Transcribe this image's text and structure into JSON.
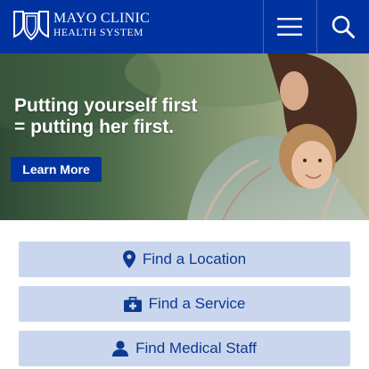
{
  "header": {
    "brand_line1": "MAYO CLINIC",
    "brand_line2": "HEALTH SYSTEM",
    "menu_icon": "hamburger-menu-icon",
    "search_icon": "search-icon",
    "background_color": "#0033a0"
  },
  "hero": {
    "headline_line1": "Putting yourself first",
    "headline_line2": "= putting her first.",
    "cta_label": "Learn More"
  },
  "quick_links": [
    {
      "label": "Find a Location",
      "icon": "location-pin-icon"
    },
    {
      "label": "Find a Service",
      "icon": "medical-kit-icon"
    },
    {
      "label": "Find Medical Staff",
      "icon": "person-icon"
    }
  ],
  "colors": {
    "brand_blue": "#0033a0",
    "quick_link_bg": "#c9d6ee",
    "quick_link_text": "#0d3a8f"
  }
}
